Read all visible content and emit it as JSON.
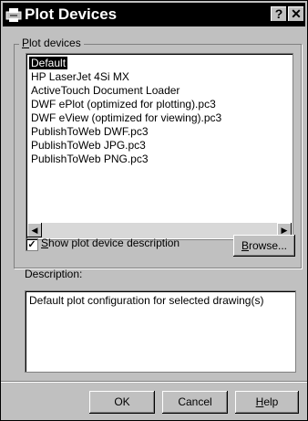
{
  "window": {
    "title": "Plot Devices",
    "help_button": "?",
    "close_button": "✕"
  },
  "group": {
    "label": "Plot devices",
    "label_mnemonic": "P",
    "label_rest": "lot devices"
  },
  "devices": [
    {
      "label": "Default",
      "selected": true
    },
    {
      "label": "HP LaserJet 4Si MX",
      "selected": false
    },
    {
      "label": "ActiveTouch Document Loader",
      "selected": false
    },
    {
      "label": "DWF ePlot (optimized for plotting).pc3",
      "selected": false
    },
    {
      "label": "DWF eView (optimized for viewing).pc3",
      "selected": false
    },
    {
      "label": "PublishToWeb DWF.pc3",
      "selected": false
    },
    {
      "label": "PublishToWeb JPG.pc3",
      "selected": false
    },
    {
      "label": "PublishToWeb PNG.pc3",
      "selected": false
    }
  ],
  "scroll_left": "◀",
  "scroll_right": "▶",
  "show_description": {
    "checked": true,
    "mark": "✓",
    "mnemonic": "S",
    "rest": "how plot device description"
  },
  "browse": {
    "mnemonic": "B",
    "rest": "rowse..."
  },
  "description_label": "Description:",
  "description_text": "Default plot configuration for selected drawing(s)",
  "buttons": {
    "ok": "OK",
    "cancel": "Cancel",
    "help_mnemonic": "H",
    "help_rest": "elp"
  }
}
